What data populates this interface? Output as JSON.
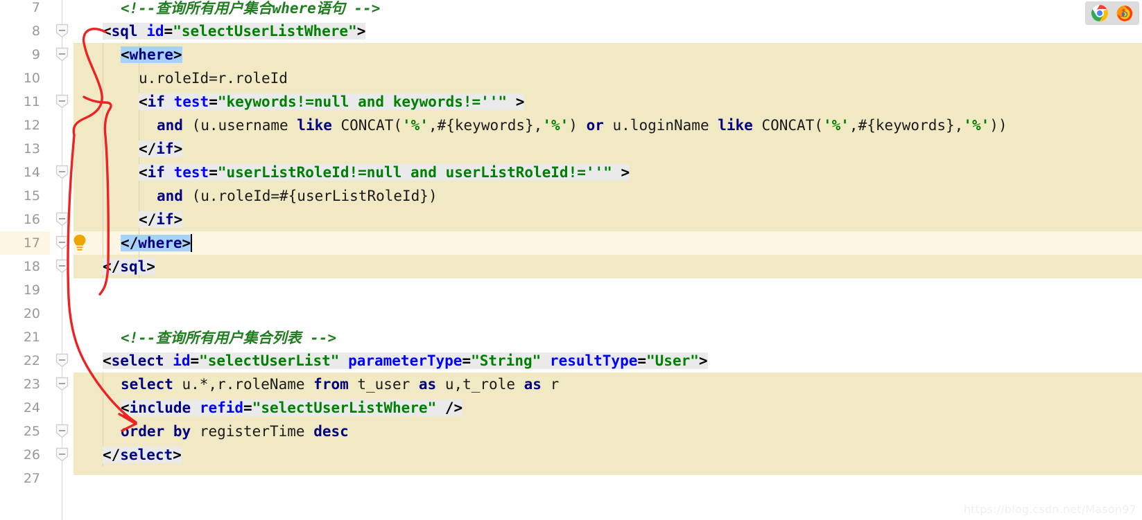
{
  "editor": {
    "font_size_px": 21,
    "line_height_px": 34,
    "first_visible_line": 7,
    "last_visible_line": 27,
    "current_line": 17,
    "colors": {
      "background": "#ffffff",
      "selection_block": "#f0e9c3",
      "current_line": "#fdf6e3",
      "tag_line_background": "#eaeaea",
      "matching_tag_highlight": "#a6d2ff",
      "gutter_text": "#999999",
      "comment": "#207d20",
      "tag_name": "#000080",
      "attribute_name": "#0000ff",
      "attribute_value": "#008000",
      "annotation_arrow": "#ee2222",
      "watermark": "#f0f0f0"
    }
  },
  "gutter": {
    "line_numbers": [
      7,
      8,
      9,
      10,
      11,
      12,
      13,
      14,
      15,
      16,
      17,
      18,
      19,
      20,
      21,
      22,
      23,
      24,
      25,
      26,
      27
    ],
    "fold_marker_lines": [
      8,
      9,
      11,
      14,
      16,
      17,
      18,
      22,
      23,
      25,
      26
    ],
    "bulb_line": 17,
    "bulb_icon": "lightbulb-icon"
  },
  "code_lines": [
    {
      "n": 7,
      "indent": 1,
      "tokens": [
        {
          "text": "<!--查询所有用户集合where语句 -->",
          "cls": "t-comment"
        }
      ]
    },
    {
      "n": 8,
      "indent": 0,
      "bg": "tagline",
      "tokens": [
        {
          "text": "<",
          "cls": "t-punct"
        },
        {
          "text": "sql",
          "cls": "t-tag"
        },
        {
          "text": " ",
          "cls": "t-plain"
        },
        {
          "text": "id",
          "cls": "t-attr"
        },
        {
          "text": "=",
          "cls": "t-punct"
        },
        {
          "text": "\"selectUserListWhere\"",
          "cls": "t-str"
        },
        {
          "text": ">",
          "cls": "t-punct"
        }
      ]
    },
    {
      "n": 9,
      "indent": 1,
      "bg": "match",
      "tokens": [
        {
          "text": "<",
          "cls": "t-punct"
        },
        {
          "text": "where",
          "cls": "t-tag"
        },
        {
          "text": ">",
          "cls": "t-punct"
        }
      ]
    },
    {
      "n": 10,
      "indent": 2,
      "tokens": [
        {
          "text": "u.roleId=r.roleId",
          "cls": "t-plain"
        }
      ]
    },
    {
      "n": 11,
      "indent": 2,
      "bg": "tagline",
      "tokens": [
        {
          "text": "<",
          "cls": "t-punct"
        },
        {
          "text": "if",
          "cls": "t-tag"
        },
        {
          "text": " ",
          "cls": "t-plain"
        },
        {
          "text": "test",
          "cls": "t-attr"
        },
        {
          "text": "=",
          "cls": "t-punct"
        },
        {
          "text": "\"keywords!=null and keywords!=''\"",
          "cls": "t-str"
        },
        {
          "text": " >",
          "cls": "t-punct"
        }
      ]
    },
    {
      "n": 12,
      "indent": 3,
      "tokens": [
        {
          "text": "and ",
          "cls": "t-kw"
        },
        {
          "text": "(u.username ",
          "cls": "t-plain"
        },
        {
          "text": "like",
          "cls": "t-kw"
        },
        {
          "text": " CONCAT(",
          "cls": "t-plain"
        },
        {
          "text": "'%'",
          "cls": "t-pct"
        },
        {
          "text": ",#{keywords},",
          "cls": "t-plain"
        },
        {
          "text": "'%'",
          "cls": "t-pct"
        },
        {
          "text": ") ",
          "cls": "t-plain"
        },
        {
          "text": "or",
          "cls": "t-kw"
        },
        {
          "text": " u.loginName ",
          "cls": "t-plain"
        },
        {
          "text": "like",
          "cls": "t-kw"
        },
        {
          "text": " CONCAT(",
          "cls": "t-plain"
        },
        {
          "text": "'%'",
          "cls": "t-pct"
        },
        {
          "text": ",#{keywords},",
          "cls": "t-plain"
        },
        {
          "text": "'%'",
          "cls": "t-pct"
        },
        {
          "text": "))",
          "cls": "t-plain"
        }
      ]
    },
    {
      "n": 13,
      "indent": 2,
      "bg": "tagline",
      "tokens": [
        {
          "text": "</",
          "cls": "t-punct"
        },
        {
          "text": "if",
          "cls": "t-tag"
        },
        {
          "text": ">",
          "cls": "t-punct"
        }
      ]
    },
    {
      "n": 14,
      "indent": 2,
      "bg": "tagline",
      "tokens": [
        {
          "text": "<",
          "cls": "t-punct"
        },
        {
          "text": "if",
          "cls": "t-tag"
        },
        {
          "text": " ",
          "cls": "t-plain"
        },
        {
          "text": "test",
          "cls": "t-attr"
        },
        {
          "text": "=",
          "cls": "t-punct"
        },
        {
          "text": "\"userListRoleId!=null and userListRoleId!=''\"",
          "cls": "t-str"
        },
        {
          "text": " >",
          "cls": "t-punct"
        }
      ]
    },
    {
      "n": 15,
      "indent": 3,
      "tokens": [
        {
          "text": "and ",
          "cls": "t-kw"
        },
        {
          "text": "(u.roleId=#{userListRoleId})",
          "cls": "t-plain"
        }
      ]
    },
    {
      "n": 16,
      "indent": 2,
      "bg": "tagline",
      "tokens": [
        {
          "text": "</",
          "cls": "t-punct"
        },
        {
          "text": "if",
          "cls": "t-tag"
        },
        {
          "text": ">",
          "cls": "t-punct"
        }
      ]
    },
    {
      "n": 17,
      "indent": 1,
      "bg": "match",
      "caret": true,
      "tokens": [
        {
          "text": "</",
          "cls": "t-punct"
        },
        {
          "text": "where",
          "cls": "t-tag"
        },
        {
          "text": ">",
          "cls": "t-punct"
        }
      ]
    },
    {
      "n": 18,
      "indent": 0,
      "bg": "tagline",
      "tokens": [
        {
          "text": "</",
          "cls": "t-punct"
        },
        {
          "text": "sql",
          "cls": "t-tag"
        },
        {
          "text": ">",
          "cls": "t-punct"
        }
      ]
    },
    {
      "n": 19,
      "indent": 0,
      "tokens": []
    },
    {
      "n": 20,
      "indent": 0,
      "tokens": []
    },
    {
      "n": 21,
      "indent": 1,
      "tokens": [
        {
          "text": "<!--查询所有用户集合列表 -->",
          "cls": "t-comment"
        }
      ]
    },
    {
      "n": 22,
      "indent": 0,
      "bg": "tagline",
      "tokens": [
        {
          "text": "<",
          "cls": "t-punct"
        },
        {
          "text": "select",
          "cls": "t-tag"
        },
        {
          "text": " ",
          "cls": "t-plain"
        },
        {
          "text": "id",
          "cls": "t-attr"
        },
        {
          "text": "=",
          "cls": "t-punct"
        },
        {
          "text": "\"selectUserList\"",
          "cls": "t-str"
        },
        {
          "text": " ",
          "cls": "t-plain"
        },
        {
          "text": "parameterType",
          "cls": "t-attr"
        },
        {
          "text": "=",
          "cls": "t-punct"
        },
        {
          "text": "\"String\"",
          "cls": "t-str"
        },
        {
          "text": " ",
          "cls": "t-plain"
        },
        {
          "text": "resultType",
          "cls": "t-attr"
        },
        {
          "text": "=",
          "cls": "t-punct"
        },
        {
          "text": "\"User\"",
          "cls": "t-str"
        },
        {
          "text": ">",
          "cls": "t-punct"
        }
      ]
    },
    {
      "n": 23,
      "indent": 1,
      "tokens": [
        {
          "text": "select",
          "cls": "t-kw"
        },
        {
          "text": " u.*,r.roleName ",
          "cls": "t-plain"
        },
        {
          "text": "from",
          "cls": "t-kw"
        },
        {
          "text": " t_user ",
          "cls": "t-plain"
        },
        {
          "text": "as",
          "cls": "t-kw"
        },
        {
          "text": " u,t_role ",
          "cls": "t-plain"
        },
        {
          "text": "as",
          "cls": "t-kw"
        },
        {
          "text": " r",
          "cls": "t-plain"
        }
      ]
    },
    {
      "n": 24,
      "indent": 1,
      "bg": "tagline",
      "tokens": [
        {
          "text": "<",
          "cls": "t-punct"
        },
        {
          "text": "include",
          "cls": "t-tag"
        },
        {
          "text": " ",
          "cls": "t-plain"
        },
        {
          "text": "refid",
          "cls": "t-attr"
        },
        {
          "text": "=",
          "cls": "t-punct"
        },
        {
          "text": "\"selectUserListWhere\"",
          "cls": "t-str"
        },
        {
          "text": " />",
          "cls": "t-punct"
        }
      ]
    },
    {
      "n": 25,
      "indent": 1,
      "tokens": [
        {
          "text": "order",
          "cls": "t-kw"
        },
        {
          "text": " ",
          "cls": "t-plain"
        },
        {
          "text": "by",
          "cls": "t-kw"
        },
        {
          "text": " registerTime ",
          "cls": "t-plain"
        },
        {
          "text": "desc",
          "cls": "t-kw"
        }
      ]
    },
    {
      "n": 26,
      "indent": 0,
      "bg": "tagline",
      "tokens": [
        {
          "text": "</",
          "cls": "t-punct"
        },
        {
          "text": "select",
          "cls": "t-tag"
        },
        {
          "text": ">",
          "cls": "t-punct"
        }
      ]
    },
    {
      "n": 27,
      "indent": 0,
      "tokens": []
    }
  ],
  "annotations": {
    "arrow_color": "#ee2222",
    "items": [
      {
        "name": "annotation-loop-sql-to-include",
        "desc": "red hand-drawn curve from <sql> tag down to the <include refid> line"
      },
      {
        "name": "annotation-arrowhead-include",
        "desc": "red arrowhead pointing at <include refid=\"selectUserListWhere\" />"
      }
    ]
  },
  "tray": {
    "icons": [
      {
        "name": "chrome-icon",
        "label": "Google Chrome"
      },
      {
        "name": "firefox-icon",
        "label": "Mozilla Firefox"
      }
    ]
  },
  "watermark": {
    "text": "https://blog.csdn.net/Mason97"
  }
}
